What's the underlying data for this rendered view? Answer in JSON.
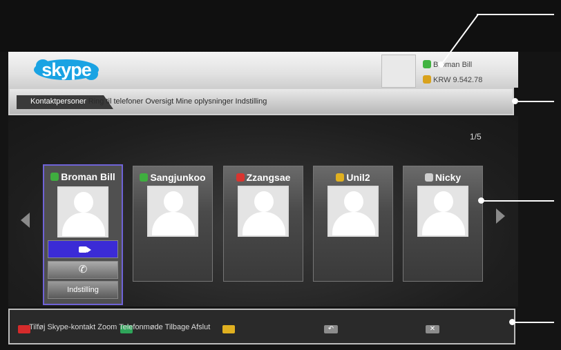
{
  "header": {
    "logo": "skype",
    "user_name": "Broman Bill",
    "credit": "KRW 9.542.78"
  },
  "menu": {
    "active": "Kontaktpersoner",
    "rest": "Ring til telefoner Oversigt Mine oplysninger Indstilling"
  },
  "pager": "1/5",
  "contacts": [
    {
      "name": "Broman Bill",
      "status": "green"
    },
    {
      "name": "Sangjunkoo",
      "status": "green"
    },
    {
      "name": "Zzangsae",
      "status": "red"
    },
    {
      "name": "Unil2",
      "status": "yellow"
    },
    {
      "name": "Nicky",
      "status": "gray"
    }
  ],
  "selected_actions": {
    "video_icon": "video-camera-icon",
    "call_icon": "phone-icon",
    "settings_label": "Indstilling"
  },
  "footer": {
    "text": "Tilføj Skype-kontakt Zoom Telefonmøde Tilbage Afslut",
    "back_glyph": "↶",
    "close_glyph": "✕"
  }
}
